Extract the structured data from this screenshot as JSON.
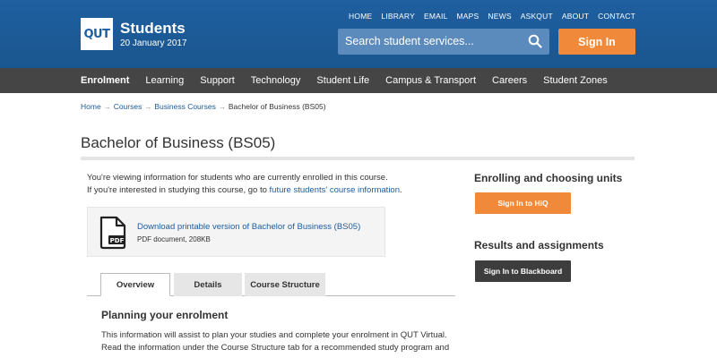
{
  "header": {
    "logo_text": "QUT",
    "site_name": "Students",
    "date": "20 January 2017",
    "top_links": [
      "HOME",
      "LIBRARY",
      "EMAIL",
      "MAPS",
      "NEWS",
      "ASKQUT",
      "ABOUT",
      "CONTACT"
    ],
    "search_placeholder": "Search student services...",
    "sign_in_label": "Sign In"
  },
  "nav": {
    "items": [
      "Enrolment",
      "Learning",
      "Support",
      "Technology",
      "Student Life",
      "Campus & Transport",
      "Careers",
      "Student Zones"
    ],
    "active": "Enrolment"
  },
  "breadcrumb": {
    "items": [
      "Home",
      "Courses",
      "Business Courses"
    ],
    "current": "Bachelor of Business (BS05)"
  },
  "main": {
    "title": "Bachelor of Business (BS05)",
    "intro_line1": "You're viewing information for students who are currently enrolled in this course.",
    "intro_line2_prefix": "If you're interested in studying this course, go to ",
    "intro_link": "future students' course information",
    "intro_line2_suffix": ".",
    "download": {
      "icon_label": "PDF",
      "link": "Download printable version of Bachelor of Business (BS05)",
      "meta": "PDF document, 208KB"
    },
    "tabs": [
      "Overview",
      "Details",
      "Course Structure"
    ],
    "active_tab": "Overview",
    "section_heading": "Planning your enrolment",
    "body_text": "This information will assist to plan your studies and complete your enrolment in QUT Virtual. Read the information under the Course Structure tab for a recommended study program and"
  },
  "sidebar": {
    "heading1": "Enrolling and choosing units",
    "button1": "Sign In to HiQ",
    "heading2": "Results and assignments",
    "button2": "Sign In to Blackboard"
  },
  "colors": {
    "header_blue": "#1d5b9a",
    "accent_orange": "#f08a3a",
    "nav_dark": "#454545",
    "link_blue": "#1d5b9a"
  }
}
